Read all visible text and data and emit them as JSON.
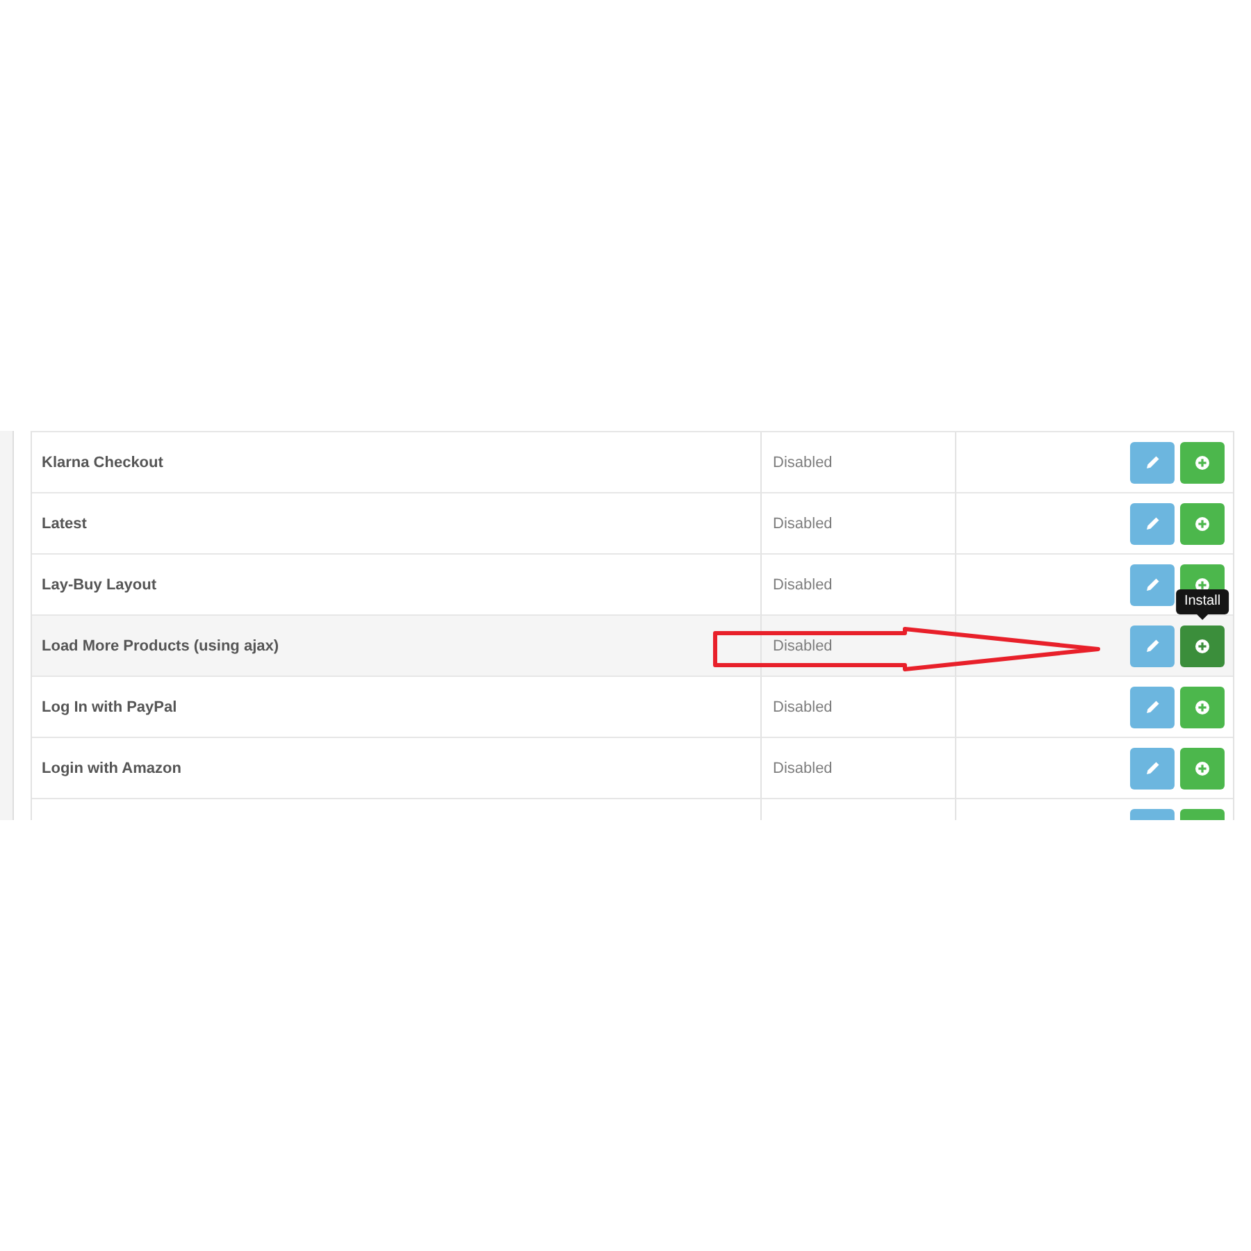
{
  "module_table": {
    "rows": [
      {
        "kind": "row",
        "name": "Klarna Checkout",
        "status": "Disabled",
        "hovered": false,
        "annotated": false
      },
      {
        "kind": "row",
        "name": "Latest",
        "status": "Disabled",
        "hovered": false,
        "annotated": false
      },
      {
        "kind": "row",
        "name": "Lay-Buy Layout",
        "status": "Disabled",
        "hovered": false,
        "annotated": false
      },
      {
        "kind": "row",
        "name": "Load More Products (using ajax)",
        "status": "Disabled",
        "hovered": true,
        "annotated": true,
        "tooltip": "Install"
      },
      {
        "kind": "row",
        "name": "Log In with PayPal",
        "status": "Disabled",
        "hovered": false,
        "annotated": false
      },
      {
        "kind": "row",
        "name": "Login with Amazon",
        "status": "Disabled",
        "hovered": false,
        "annotated": false
      },
      {
        "kind": "cut"
      }
    ]
  }
}
